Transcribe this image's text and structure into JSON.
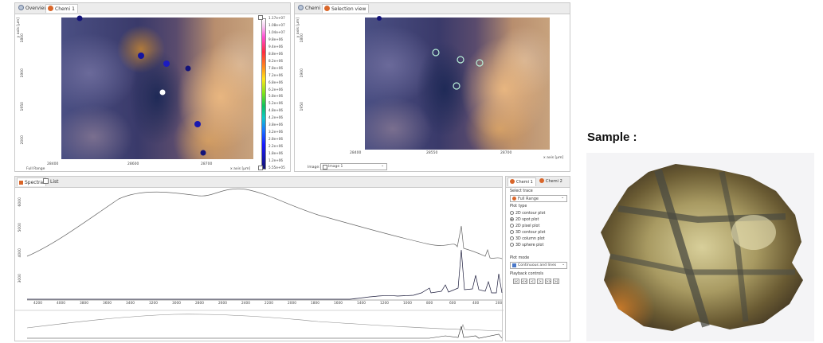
{
  "left_panel": {
    "tabs": [
      "Overview",
      "Chemi 1"
    ],
    "y_axis_label": "y axis [µm]",
    "x_axis_label": "x axis [µm]",
    "range_label": "Full Range",
    "x_ticks": [
      "28400",
      "28600",
      "28700"
    ],
    "y_ticks": [
      "1800",
      "1900",
      "1950",
      "2000"
    ],
    "colorbar_labels": [
      "1.17e+07",
      "1.08e+07",
      "1.04e+07",
      "9.8e+06",
      "9.4e+06",
      "8.8e+06",
      "8.2e+06",
      "7.8e+06",
      "7.2e+06",
      "6.8e+06",
      "6.2e+06",
      "5.8e+06",
      "5.2e+06",
      "4.8e+06",
      "4.2e+06",
      "3.8e+06",
      "3.2e+06",
      "2.8e+06",
      "2.2e+06",
      "1.8e+06",
      "1.2e+06",
      "5.55e+05"
    ]
  },
  "right_panel": {
    "tabs": [
      "Chemi 2",
      "Selection view"
    ],
    "y_axis_label": "y axis [µm]",
    "x_axis_label": "x axis [µm]",
    "x_ticks": [
      "28400",
      "28550",
      "28700"
    ],
    "y_ticks": [
      "1800",
      "1900",
      "1950"
    ],
    "image_label": "Image:",
    "image_value": "Image 1"
  },
  "spectra_panel": {
    "tabs": [
      "Spectra",
      "List"
    ],
    "x_ticks": [
      "4200",
      "4000",
      "3800",
      "3600",
      "3400",
      "3200",
      "3000",
      "2800",
      "2600",
      "2400",
      "2200",
      "2000",
      "1800",
      "1600",
      "1400",
      "1200",
      "1000",
      "800",
      "600",
      "400",
      "200"
    ],
    "y_ticks": [
      "3000",
      "4000",
      "5000",
      "6000"
    ]
  },
  "control_panel": {
    "tabs": [
      "Chemi 1",
      "Chemi 2"
    ],
    "select_trace_label": "Select trace",
    "select_trace_value": "Full Range",
    "plot_type_label": "Plot type",
    "plot_types": [
      {
        "label": "2D contour plot",
        "selected": false
      },
      {
        "label": "2D spot plot",
        "selected": true
      },
      {
        "label": "2D pixel plot",
        "selected": false
      },
      {
        "label": "3D contour plot",
        "selected": false
      },
      {
        "label": "3D column plot",
        "selected": false
      },
      {
        "label": "3D sphere plot",
        "selected": false
      }
    ],
    "plot_mode_label": "Plot mode",
    "plot_mode_value": "Continuous and lines",
    "playback_label": "Playback controls",
    "playback_buttons": [
      "|<",
      "<<",
      "<",
      ">",
      ">>",
      ">|"
    ]
  },
  "sample": {
    "title": "Sample :"
  },
  "colors": {
    "accent": "#1a1a8c",
    "tab_bar": "#ececec",
    "orange_icon": "#d9662a"
  }
}
